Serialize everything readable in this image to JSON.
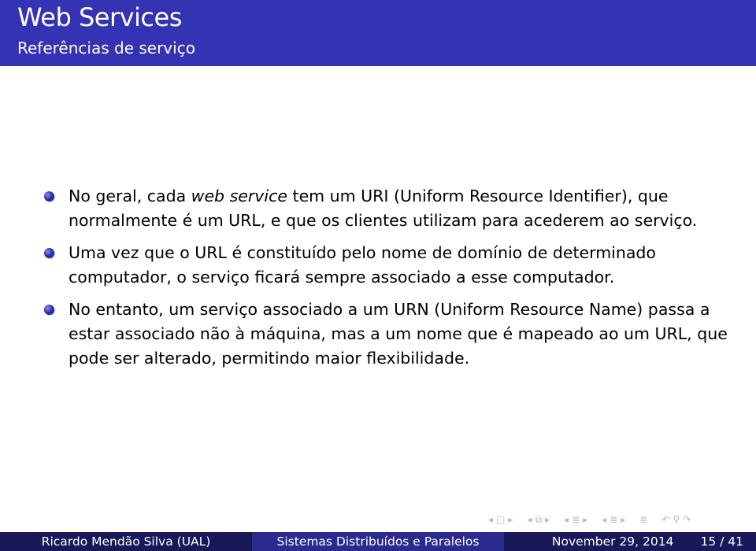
{
  "header": {
    "title": "Web Services",
    "subtitle": "Referências de serviço"
  },
  "bullets": [
    {
      "pre": "No geral, cada ",
      "emph": "web service",
      "post": " tem um URI (Uniform Resource Identifier), que normalmente é um URL, e que os clientes utilizam para acederem ao serviço."
    },
    {
      "text": "Uma vez que o URL é constituído pelo nome de domínio de determinado computador, o serviço ficará sempre associado a esse computador."
    },
    {
      "text": "No entanto, um serviço associado a um URN (Uniform Resource Name) passa a estar associado não à máquina, mas a um nome que é mapeado ao um URL, que pode ser alterado, permitindo maior flexibilidade."
    }
  ],
  "nav": {
    "icons": [
      "arrow-left",
      "frame",
      "arrow-right",
      "arrow-left",
      "subsection",
      "arrow-right",
      "arrow-left",
      "section",
      "arrow-right",
      "arrow-left",
      "document",
      "arrow-right",
      "toc",
      "back",
      "search",
      "forward"
    ],
    "glyphs": {
      "left": "◂",
      "right": "▸",
      "frame": "□",
      "subsection": "⧉",
      "section": "≣",
      "doc": "≣",
      "toc": "≣",
      "back": "↶",
      "search": "⚲",
      "forward": "↷"
    }
  },
  "footer": {
    "author": "Ricardo Mendão Silva  (UAL)",
    "course": "Sistemas Distribuídos e Paralelos",
    "date": "November 29, 2014",
    "page": "15 / 41"
  },
  "colors": {
    "header_bg": "#3333b3",
    "footer_dark": "#191959",
    "footer_mid": "#2a2a8f"
  }
}
